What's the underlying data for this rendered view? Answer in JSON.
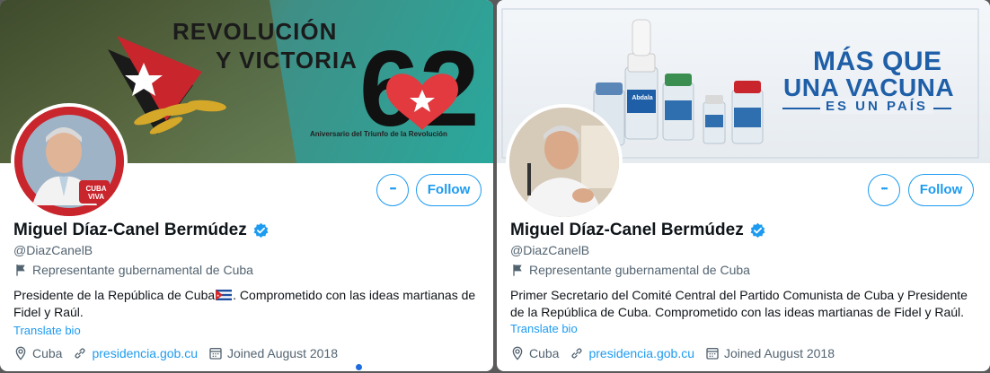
{
  "left": {
    "banner": {
      "headline_1": "REVOLUCIÓN",
      "headline_2": "Y VICTORIA",
      "number": "62",
      "subtitle": "Aniversario del Triunfo de la Revolución"
    },
    "avatar_badge": "CUBA VIVA",
    "more_label": "•••",
    "follow_label": "Follow",
    "name": "Miguel Díaz-Canel Bermúdez",
    "handle": "@DiazCanelB",
    "category": "Representante gubernamental de Cuba",
    "bio_part1": "Presidente de la República de Cuba",
    "bio_part2": ". Comprometido con las ideas martianas de Fidel y Raúl.",
    "translate": "Translate bio",
    "location": "Cuba",
    "website": "presidencia.gob.cu",
    "joined": "Joined August 2018"
  },
  "right": {
    "banner": {
      "line_1": "MÁS QUE",
      "line_2": "UNA VACUNA",
      "line_3": "ES UN PAÍS",
      "vial_label": "Abdala"
    },
    "more_label": "•••",
    "follow_label": "Follow",
    "name": "Miguel Díaz-Canel Bermúdez",
    "handle": "@DiazCanelB",
    "category": "Representante gubernamental de Cuba",
    "bio": "Primer Secretario del Comité Central del Partido Comunista de Cuba y Presidente de la República de Cuba. Comprometido con las ideas martianas de Fidel y Raúl.",
    "translate": "Translate bio",
    "location": "Cuba",
    "website": "presidencia.gob.cu",
    "joined": "Joined August 2018"
  },
  "colors": {
    "accent": "#1d9bf0",
    "secondary_text": "#536471",
    "primary_text": "#0f1419",
    "cuba_red": "#c9252d",
    "vaccine_blue": "#1f5fa8"
  },
  "icons": [
    "verified-badge-icon",
    "flag-icon",
    "location-pin-icon",
    "link-icon",
    "calendar-icon",
    "more-horizontal-icon"
  ]
}
